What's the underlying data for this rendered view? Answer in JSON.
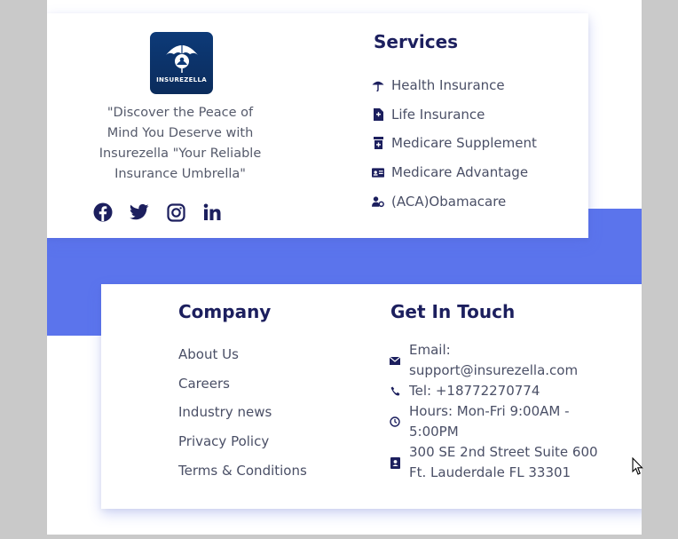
{
  "brand": {
    "logo_text": "INSUREZELLA",
    "tagline_lines": [
      "\"Discover the Peace of",
      "Mind You Deserve with",
      "Insurezella \"Your Reliable",
      "Insurance Umbrella\""
    ],
    "colors": {
      "band": "#5b74ec",
      "heading": "#1c1f5e",
      "icon": "#1c1f5e",
      "logo_bg": "#0d3a78"
    }
  },
  "socials": [
    {
      "icon": "facebook-icon"
    },
    {
      "icon": "twitter-icon"
    },
    {
      "icon": "instagram-icon"
    },
    {
      "icon": "linkedin-icon"
    }
  ],
  "services": {
    "title": "Services",
    "items": [
      {
        "label": "Health Insurance",
        "icon": "umbrella-icon"
      },
      {
        "label": "Life Insurance",
        "icon": "document-icon"
      },
      {
        "label": "Medicare Supplement",
        "icon": "pill-bottle-icon"
      },
      {
        "label": "Medicare Advantage",
        "icon": "id-card-icon"
      },
      {
        "label": "(ACA)Obamacare",
        "icon": "user-gear-icon"
      }
    ]
  },
  "company": {
    "title": "Company",
    "items": [
      {
        "label": "About Us"
      },
      {
        "label": "Careers"
      },
      {
        "label": "Industry news"
      },
      {
        "label": "Privacy Policy"
      },
      {
        "label": "Terms & Conditions"
      }
    ]
  },
  "contact": {
    "title": "Get In Touch",
    "email_line1": "Email:",
    "email_line2": "support@insurezella.com",
    "phone": "Tel: +18772270774",
    "hours_line1": "Hours: Mon-Fri 9:00AM -",
    "hours_line2": "5:00PM",
    "address_line1": "300 SE 2nd Street Suite 600",
    "address_line2": "Ft. Lauderdale FL 33301"
  }
}
